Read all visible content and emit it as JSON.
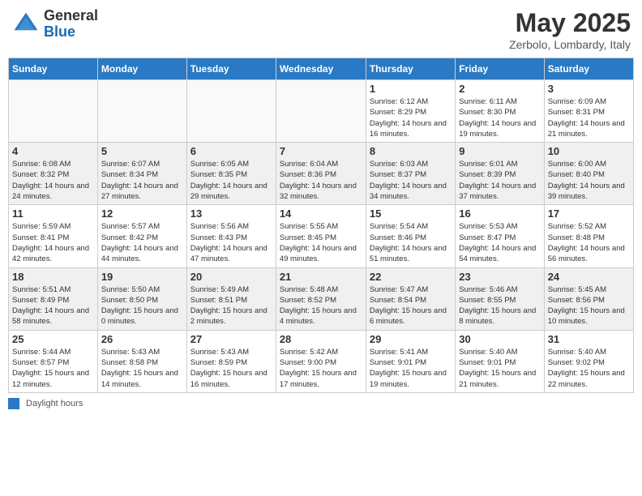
{
  "header": {
    "logo_general": "General",
    "logo_blue": "Blue",
    "month_title": "May 2025",
    "location": "Zerbolo, Lombardy, Italy"
  },
  "days_of_week": [
    "Sunday",
    "Monday",
    "Tuesday",
    "Wednesday",
    "Thursday",
    "Friday",
    "Saturday"
  ],
  "weeks": [
    [
      {
        "day": "",
        "info": ""
      },
      {
        "day": "",
        "info": ""
      },
      {
        "day": "",
        "info": ""
      },
      {
        "day": "",
        "info": ""
      },
      {
        "day": "1",
        "info": "Sunrise: 6:12 AM\nSunset: 8:29 PM\nDaylight: 14 hours and 16 minutes."
      },
      {
        "day": "2",
        "info": "Sunrise: 6:11 AM\nSunset: 8:30 PM\nDaylight: 14 hours and 19 minutes."
      },
      {
        "day": "3",
        "info": "Sunrise: 6:09 AM\nSunset: 8:31 PM\nDaylight: 14 hours and 21 minutes."
      }
    ],
    [
      {
        "day": "4",
        "info": "Sunrise: 6:08 AM\nSunset: 8:32 PM\nDaylight: 14 hours and 24 minutes."
      },
      {
        "day": "5",
        "info": "Sunrise: 6:07 AM\nSunset: 8:34 PM\nDaylight: 14 hours and 27 minutes."
      },
      {
        "day": "6",
        "info": "Sunrise: 6:05 AM\nSunset: 8:35 PM\nDaylight: 14 hours and 29 minutes."
      },
      {
        "day": "7",
        "info": "Sunrise: 6:04 AM\nSunset: 8:36 PM\nDaylight: 14 hours and 32 minutes."
      },
      {
        "day": "8",
        "info": "Sunrise: 6:03 AM\nSunset: 8:37 PM\nDaylight: 14 hours and 34 minutes."
      },
      {
        "day": "9",
        "info": "Sunrise: 6:01 AM\nSunset: 8:39 PM\nDaylight: 14 hours and 37 minutes."
      },
      {
        "day": "10",
        "info": "Sunrise: 6:00 AM\nSunset: 8:40 PM\nDaylight: 14 hours and 39 minutes."
      }
    ],
    [
      {
        "day": "11",
        "info": "Sunrise: 5:59 AM\nSunset: 8:41 PM\nDaylight: 14 hours and 42 minutes."
      },
      {
        "day": "12",
        "info": "Sunrise: 5:57 AM\nSunset: 8:42 PM\nDaylight: 14 hours and 44 minutes."
      },
      {
        "day": "13",
        "info": "Sunrise: 5:56 AM\nSunset: 8:43 PM\nDaylight: 14 hours and 47 minutes."
      },
      {
        "day": "14",
        "info": "Sunrise: 5:55 AM\nSunset: 8:45 PM\nDaylight: 14 hours and 49 minutes."
      },
      {
        "day": "15",
        "info": "Sunrise: 5:54 AM\nSunset: 8:46 PM\nDaylight: 14 hours and 51 minutes."
      },
      {
        "day": "16",
        "info": "Sunrise: 5:53 AM\nSunset: 8:47 PM\nDaylight: 14 hours and 54 minutes."
      },
      {
        "day": "17",
        "info": "Sunrise: 5:52 AM\nSunset: 8:48 PM\nDaylight: 14 hours and 56 minutes."
      }
    ],
    [
      {
        "day": "18",
        "info": "Sunrise: 5:51 AM\nSunset: 8:49 PM\nDaylight: 14 hours and 58 minutes."
      },
      {
        "day": "19",
        "info": "Sunrise: 5:50 AM\nSunset: 8:50 PM\nDaylight: 15 hours and 0 minutes."
      },
      {
        "day": "20",
        "info": "Sunrise: 5:49 AM\nSunset: 8:51 PM\nDaylight: 15 hours and 2 minutes."
      },
      {
        "day": "21",
        "info": "Sunrise: 5:48 AM\nSunset: 8:52 PM\nDaylight: 15 hours and 4 minutes."
      },
      {
        "day": "22",
        "info": "Sunrise: 5:47 AM\nSunset: 8:54 PM\nDaylight: 15 hours and 6 minutes."
      },
      {
        "day": "23",
        "info": "Sunrise: 5:46 AM\nSunset: 8:55 PM\nDaylight: 15 hours and 8 minutes."
      },
      {
        "day": "24",
        "info": "Sunrise: 5:45 AM\nSunset: 8:56 PM\nDaylight: 15 hours and 10 minutes."
      }
    ],
    [
      {
        "day": "25",
        "info": "Sunrise: 5:44 AM\nSunset: 8:57 PM\nDaylight: 15 hours and 12 minutes."
      },
      {
        "day": "26",
        "info": "Sunrise: 5:43 AM\nSunset: 8:58 PM\nDaylight: 15 hours and 14 minutes."
      },
      {
        "day": "27",
        "info": "Sunrise: 5:43 AM\nSunset: 8:59 PM\nDaylight: 15 hours and 16 minutes."
      },
      {
        "day": "28",
        "info": "Sunrise: 5:42 AM\nSunset: 9:00 PM\nDaylight: 15 hours and 17 minutes."
      },
      {
        "day": "29",
        "info": "Sunrise: 5:41 AM\nSunset: 9:01 PM\nDaylight: 15 hours and 19 minutes."
      },
      {
        "day": "30",
        "info": "Sunrise: 5:40 AM\nSunset: 9:01 PM\nDaylight: 15 hours and 21 minutes."
      },
      {
        "day": "31",
        "info": "Sunrise: 5:40 AM\nSunset: 9:02 PM\nDaylight: 15 hours and 22 minutes."
      }
    ]
  ],
  "footer": {
    "legend_label": "Daylight hours"
  }
}
